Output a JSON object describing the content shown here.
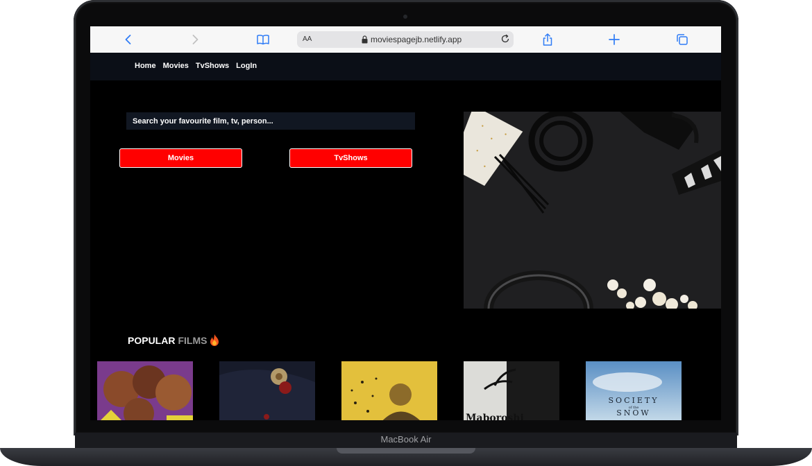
{
  "device": {
    "brand_label": "MacBook Air"
  },
  "browser": {
    "aa_label": "AA",
    "url": "moviespagejb.netlify.app"
  },
  "nav": {
    "links": [
      "Home",
      "Movies",
      "TvShows",
      "LogIn"
    ]
  },
  "search": {
    "placeholder": "Search your favourite film, tv, person..."
  },
  "buttons": {
    "movies": "Movies",
    "tvshows": "TvShows"
  },
  "popular": {
    "title_part1": "POPULAR",
    "title_part2": "FILMS",
    "icon": "fire-icon"
  },
  "posters": {
    "society_line1": "SOCIETY",
    "society_small": "of the",
    "society_line2": "SNOW",
    "maboroshi": "Maboroshi"
  },
  "colors": {
    "accent_red": "#ff0000",
    "nav_bg": "#0b0f17",
    "page_bg": "#000000",
    "safari_blue": "#2f7cf6"
  }
}
